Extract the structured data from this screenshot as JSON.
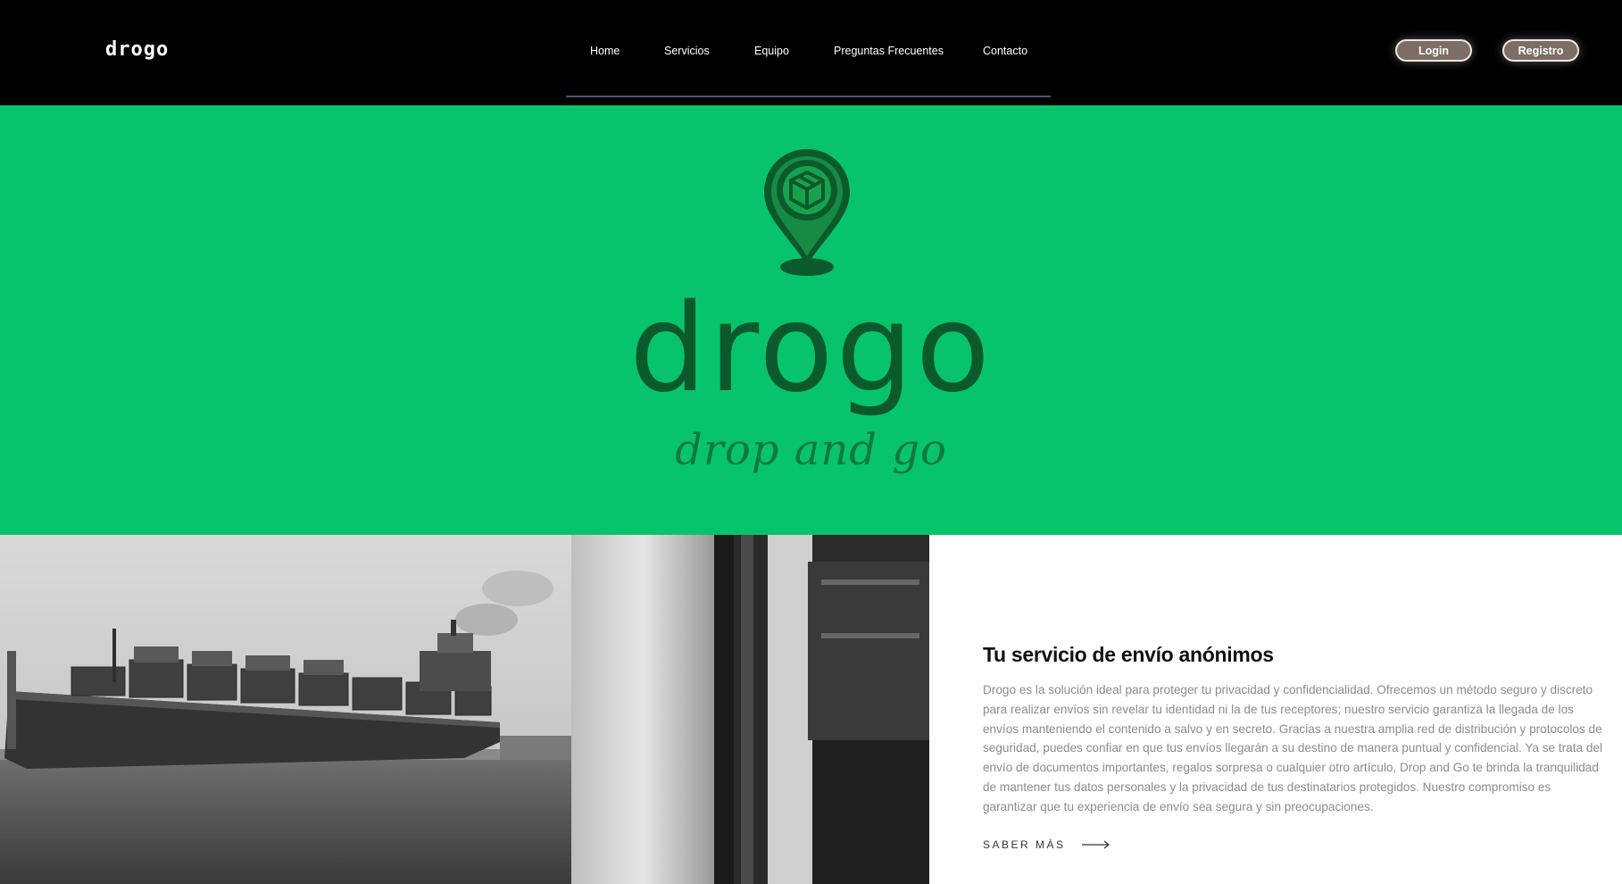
{
  "brand": {
    "name": "drogo"
  },
  "nav": {
    "items": [
      {
        "label": "Home"
      },
      {
        "label": "Servicios"
      },
      {
        "label": "Equipo"
      },
      {
        "label": "Preguntas Frecuentes"
      },
      {
        "label": "Contacto"
      }
    ]
  },
  "auth": {
    "login_label": "Login",
    "register_label": "Registro"
  },
  "hero": {
    "logo_word": "drogo",
    "tagline": "drop and go",
    "background_color": "#07c46c",
    "logo_color": "#0b5a2c"
  },
  "about": {
    "title": "Tu servicio de envío anónimos",
    "body": "Drogo es la solución ideal para proteger tu privacidad y confidencialidad. Ofrecemos un método seguro y discreto para realizar envíos sin revelar tu identidad ni la de tus receptores; nuestro servicio garantiza la llegada de los envíos manteniendo el contenido a salvo y en secreto. Gracias a nuestra amplia red de distribución y protocolos de seguridad, puedes confiar en que tus envíos llegarán a su destino de manera puntual y confidencial. Ya se trata del envío de documentos importantes, regalos sorpresa o cualquier otro artículo, Drop and Go te brinda la tranquilidad de mantener tus datos personales y la privacidad de tus destinatarios protegidos. Nuestro compromiso es garantizar que tu experiencia de envío sea segura y sin preocupaciones.",
    "more_label": "SABER MÁS"
  },
  "icons": {
    "logo": "map-pin-package-icon",
    "arrow": "arrow-right-icon"
  }
}
